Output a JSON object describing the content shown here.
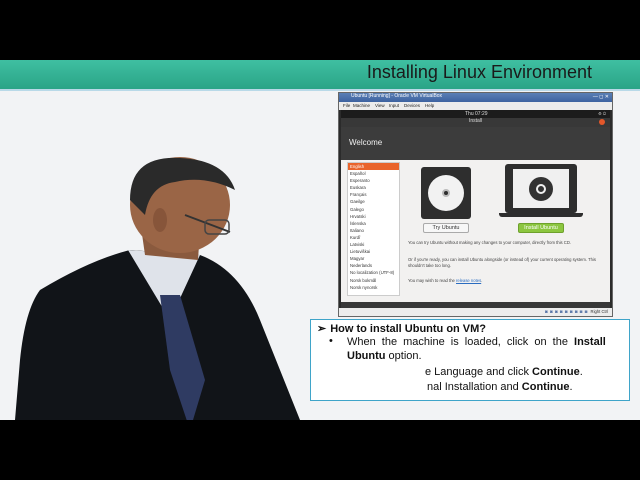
{
  "slide": {
    "title": "Installing Linux Environment"
  },
  "vm_window": {
    "title": "Ubuntu [Running] - Oracle VM VirtualBox",
    "controls": "— ◻ ✕",
    "menu": [
      "File",
      "Machine",
      "View",
      "Input",
      "Devices",
      "Help"
    ],
    "guest_clock": "Thu 07:29",
    "guest_top_icons": "⚙ ⏻",
    "installer_header": "Install",
    "welcome": "Welcome",
    "languages": [
      {
        "label": "English",
        "selected": true
      },
      {
        "label": "Español",
        "selected": false
      },
      {
        "label": "Esperanto",
        "selected": false
      },
      {
        "label": "Euskara",
        "selected": false
      },
      {
        "label": "Français",
        "selected": false
      },
      {
        "label": "Gaeilge",
        "selected": false
      },
      {
        "label": "Galego",
        "selected": false
      },
      {
        "label": "Hrvatski",
        "selected": false
      },
      {
        "label": "Íslenska",
        "selected": false
      },
      {
        "label": "Italiano",
        "selected": false
      },
      {
        "label": "Kurdî",
        "selected": false
      },
      {
        "label": "Latviski",
        "selected": false
      },
      {
        "label": "Lietuviškai",
        "selected": false
      },
      {
        "label": "Magyar",
        "selected": false
      },
      {
        "label": "Nederlands",
        "selected": false
      },
      {
        "label": "No localization (UTF-8)",
        "selected": false
      },
      {
        "label": "Norsk bokmål",
        "selected": false
      },
      {
        "label": "Norsk nynorsk",
        "selected": false
      }
    ],
    "try_button": "Try Ubuntu",
    "install_button": "Install Ubuntu",
    "desc1": "You can try Ubuntu without making any changes to your computer, directly from this CD.",
    "desc2": "Or if you're ready, you can install Ubuntu alongside (or instead of) your current operating system. This shouldn't take too long.",
    "desc3_prefix": "You may wish to read the ",
    "desc3_link": "release notes",
    "desc3_suffix": ".",
    "status_icons": "◙ ◙ ◙ ◙ ◙ ◙ ◙ ◙ ◙",
    "host_key": "Right Ctrl"
  },
  "info": {
    "heading": "How to install Ubuntu on VM?",
    "arrow": "➢",
    "bullet": "•",
    "line1_prefix": "When the machine is loaded, click on the ",
    "line1_bold": "Install",
    "line2_bold": "Ubuntu",
    "line2_suffix": " option.",
    "line3_prefix": "e Language and click ",
    "line3_bold": "Continue",
    "line3_suffix": ".",
    "line4_prefix": "nal Installation and ",
    "line4_bold": "Continue",
    "line4_suffix": "."
  },
  "colors": {
    "title_bar": "#3fbfa1",
    "accent_orange": "#e9642b",
    "install_green": "#8cc63f",
    "box_border": "#3fa4c9"
  }
}
